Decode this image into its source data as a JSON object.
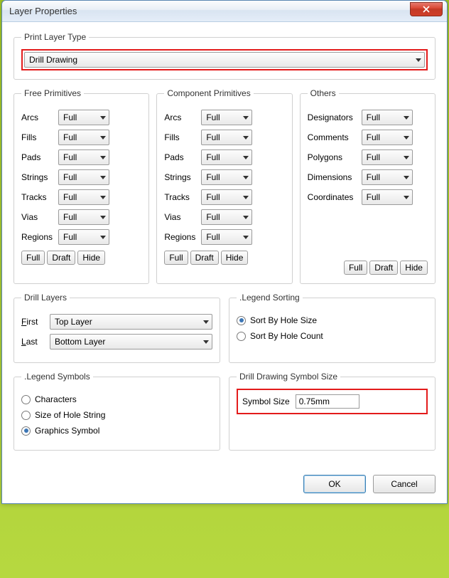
{
  "window": {
    "title": "Layer Properties"
  },
  "printLayerType": {
    "legend": "Print Layer Type",
    "value": "Drill Drawing"
  },
  "freePrimitives": {
    "legend": "Free Primitives",
    "rows": [
      {
        "label": "Arcs",
        "value": "Full"
      },
      {
        "label": "Fills",
        "value": "Full"
      },
      {
        "label": "Pads",
        "value": "Full"
      },
      {
        "label": "Strings",
        "value": "Full"
      },
      {
        "label": "Tracks",
        "value": "Full"
      },
      {
        "label": "Vias",
        "value": "Full"
      },
      {
        "label": "Regions",
        "value": "Full"
      }
    ],
    "buttons": {
      "full": "Full",
      "draft": "Draft",
      "hide": "Hide"
    }
  },
  "componentPrimitives": {
    "legend": "Component Primitives",
    "rows": [
      {
        "label": "Arcs",
        "value": "Full"
      },
      {
        "label": "Fills",
        "value": "Full"
      },
      {
        "label": "Pads",
        "value": "Full"
      },
      {
        "label": "Strings",
        "value": "Full"
      },
      {
        "label": "Tracks",
        "value": "Full"
      },
      {
        "label": "Vias",
        "value": "Full"
      },
      {
        "label": "Regions",
        "value": "Full"
      }
    ],
    "buttons": {
      "full": "Full",
      "draft": "Draft",
      "hide": "Hide"
    }
  },
  "others": {
    "legend": "Others",
    "rows": [
      {
        "label": "Designators",
        "value": "Full"
      },
      {
        "label": "Comments",
        "value": "Full"
      },
      {
        "label": "Polygons",
        "value": "Full"
      },
      {
        "label": "Dimensions",
        "value": "Full"
      },
      {
        "label": "Coordinates",
        "value": "Full"
      }
    ],
    "buttons": {
      "full": "Full",
      "draft": "Draft",
      "hide": "Hide"
    }
  },
  "drillLayers": {
    "legend": "Drill Layers",
    "first": {
      "label": "First",
      "value": "Top Layer"
    },
    "last": {
      "label": "Last",
      "value": "Bottom Layer"
    }
  },
  "legendSorting": {
    "legend": ".Legend Sorting",
    "options": [
      {
        "label": "Sort By Hole Size",
        "checked": true
      },
      {
        "label": "Sort By Hole Count",
        "checked": false
      }
    ]
  },
  "legendSymbols": {
    "legend": ".Legend Symbols",
    "options": [
      {
        "label": "Characters",
        "checked": false,
        "accel": "C"
      },
      {
        "label": "Size of Hole String",
        "checked": false,
        "accel": ""
      },
      {
        "label": "Graphics Symbol",
        "checked": true,
        "accel": "G"
      }
    ]
  },
  "symbolSize": {
    "legend": "Drill Drawing Symbol Size",
    "label": "Symbol Size",
    "value": "0.75mm"
  },
  "footer": {
    "ok": "OK",
    "cancel": "Cancel"
  }
}
